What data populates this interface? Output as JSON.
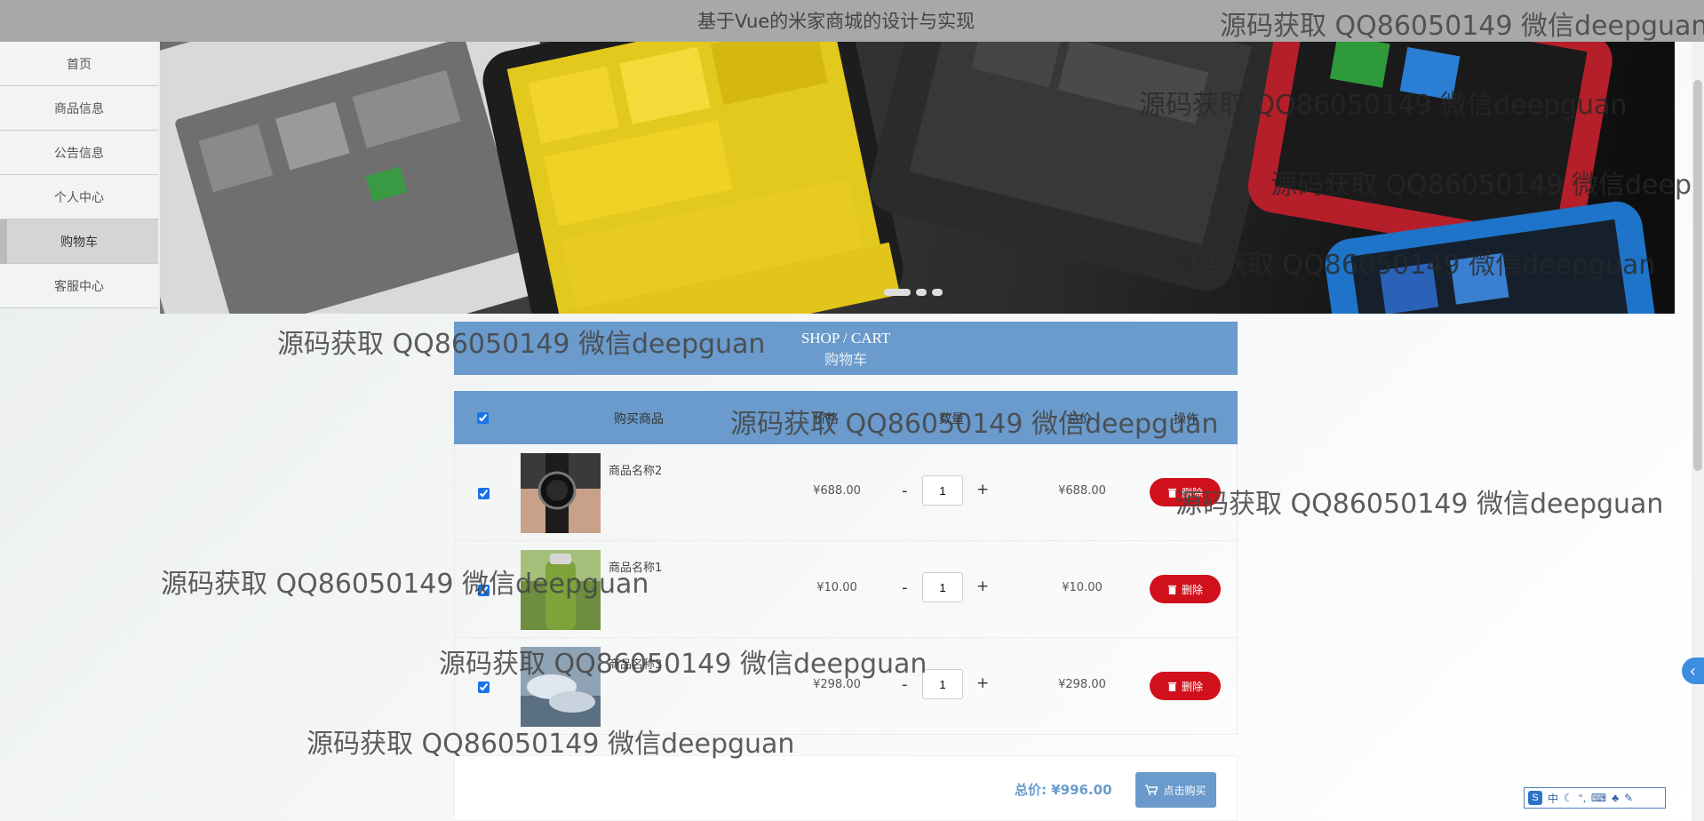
{
  "header": {
    "title": "基于Vue的米家商城的设计与实现"
  },
  "sidebar": {
    "items": [
      {
        "label": "首页"
      },
      {
        "label": "商品信息"
      },
      {
        "label": "公告信息"
      },
      {
        "label": "个人中心"
      },
      {
        "label": "购物车",
        "active": true
      },
      {
        "label": "客服中心"
      }
    ]
  },
  "banner": {
    "slides": 3,
    "active_slide": 1
  },
  "section": {
    "title_en": "SHOP / CART",
    "title_cn": "购物车"
  },
  "cart": {
    "columns": [
      "购买商品",
      "价格",
      "数量",
      "总价",
      "操作"
    ],
    "select_all": true,
    "rows": [
      {
        "name": "商品名称2",
        "price": "¥688.00",
        "qty": "1",
        "total": "¥688.00",
        "checked": true,
        "image": "watch"
      },
      {
        "name": "商品名称1",
        "price": "¥10.00",
        "qty": "1",
        "total": "¥10.00",
        "checked": true,
        "image": "bottle"
      },
      {
        "name": "商品名称3",
        "price": "¥298.00",
        "qty": "1",
        "total": "¥298.00",
        "checked": true,
        "image": "shoes"
      }
    ],
    "minus_label": "-",
    "plus_label": "+",
    "delete_label": "删除",
    "sum_label": "总价:",
    "sum_value": "¥996.00",
    "buy_label": "点击购买"
  },
  "watermark": "源码获取 QQ86050149 微信deepguan",
  "ime": {
    "mode": "中"
  },
  "colors": {
    "accent": "#6a9bcc",
    "danger": "#d0111b",
    "header": "#a7a9a8"
  }
}
